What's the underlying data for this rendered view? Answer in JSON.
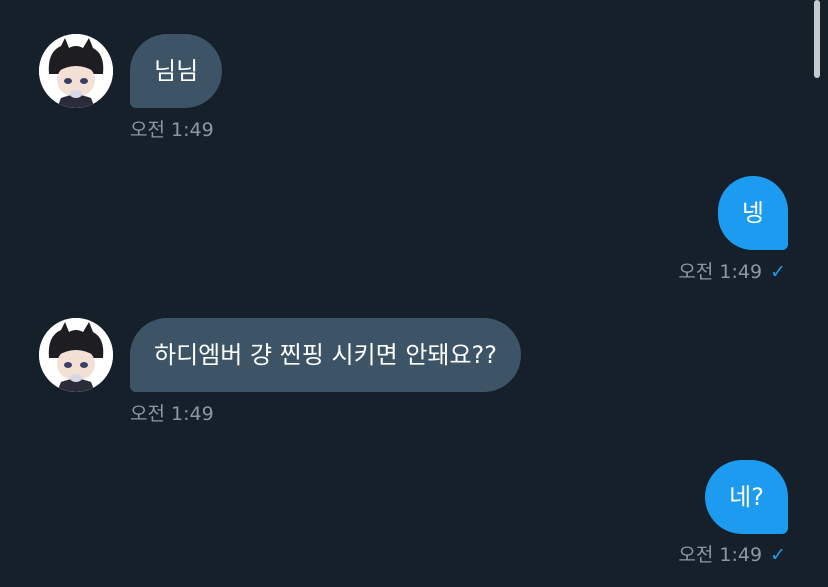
{
  "messages": [
    {
      "direction": "incoming",
      "text": "님님",
      "time": "오전 1:49"
    },
    {
      "direction": "outgoing",
      "text": "넹",
      "time": "오전 1:49"
    },
    {
      "direction": "incoming",
      "text": "하디엠버 걍 찐핑 시키면 안돼요??",
      "time": "오전 1:49"
    },
    {
      "direction": "outgoing",
      "text": "네?",
      "time": "오전 1:49"
    }
  ],
  "read_check": "✓",
  "colors": {
    "background": "#15202b",
    "incoming_bubble": "#3d5466",
    "outgoing_bubble": "#1d9bf0",
    "timestamp": "#8b98a5"
  }
}
